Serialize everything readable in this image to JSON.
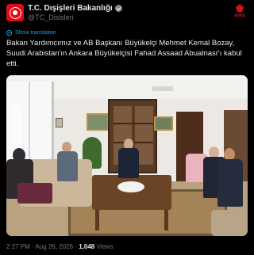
{
  "account": {
    "display_name": "T.C. Dışişleri Bakanlığı",
    "handle": "@TC_Disisleri",
    "verified": true,
    "verified_color": "#828b96"
  },
  "brand": {
    "label": "anka",
    "color": "#e30a17"
  },
  "translate": {
    "label": "Show translation",
    "color": "#1d9bf0"
  },
  "tweet": {
    "text": "Bakan Yardımcımız ve AB Başkanı Büyükelçi Mehmet Kemal Bozay, Suudi Arabistan'ın Ankara Büyükelçisi Fahad Assaad Abualnasr'ı kabul etti."
  },
  "photo": {
    "description_icon": "photo-meeting-room"
  },
  "meta": {
    "time": "2:27 PM",
    "date": "Aug 26, 2026",
    "separator": "·",
    "views_count": "1,048",
    "views_label": "Views"
  }
}
